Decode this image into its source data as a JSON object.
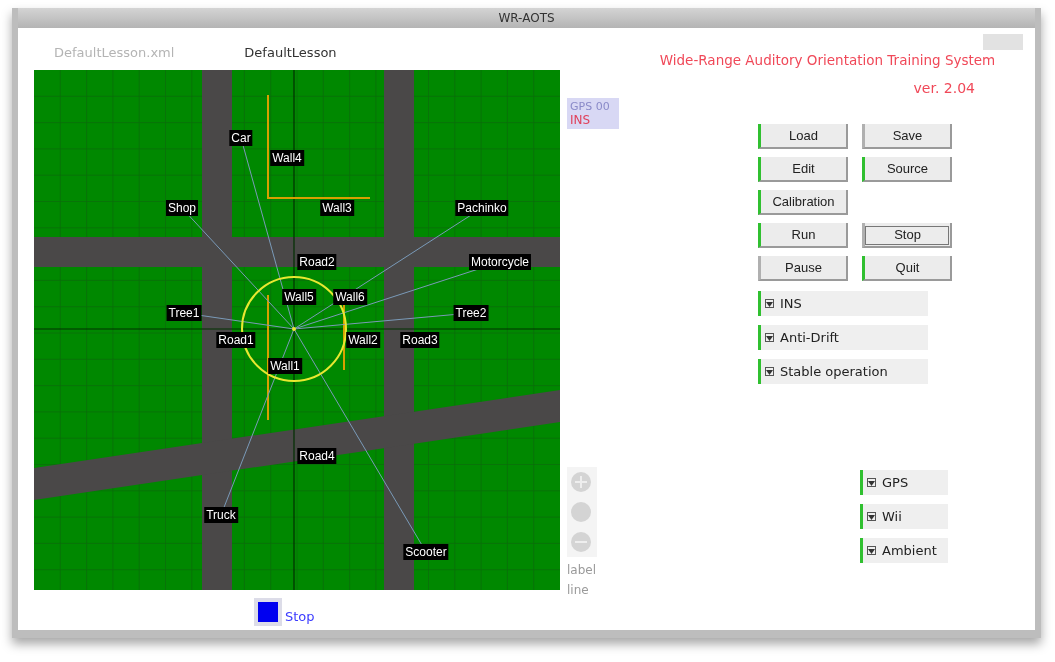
{
  "window": {
    "title": "WR-AOTS"
  },
  "header": {
    "file": "DefaultLesson.xml",
    "lesson": "DefaultLesson"
  },
  "map": {
    "labels": [
      {
        "text": "Car"
      },
      {
        "text": "Wall4"
      },
      {
        "text": "Shop"
      },
      {
        "text": "Wall3"
      },
      {
        "text": "Pachinko"
      },
      {
        "text": "Road2"
      },
      {
        "text": "Motorcycle"
      },
      {
        "text": "Wall5"
      },
      {
        "text": "Wall6"
      },
      {
        "text": "Tree1"
      },
      {
        "text": "Tree2"
      },
      {
        "text": "Road1"
      },
      {
        "text": "Wall2"
      },
      {
        "text": "Road3"
      },
      {
        "text": "Wall1"
      },
      {
        "text": "Road4"
      },
      {
        "text": "Truck"
      },
      {
        "text": "Scooter"
      }
    ]
  },
  "run_state": {
    "label": "Stop"
  },
  "status": {
    "gps": "GPS 00",
    "ins": "INS"
  },
  "zoom_panel": {
    "texts": [
      "label",
      "line"
    ]
  },
  "app_title": "Wide-Range Auditory Orientation Training System",
  "version": "ver. 2.04",
  "buttons": [
    {
      "label": "Load",
      "active": true,
      "pressed": false
    },
    {
      "label": "Save",
      "active": false,
      "pressed": false
    },
    {
      "label": "Edit",
      "active": true,
      "pressed": false
    },
    {
      "label": "Source",
      "active": true,
      "pressed": false
    },
    {
      "label": "Calibration",
      "active": true,
      "pressed": false
    },
    {
      "label": "Run",
      "active": true,
      "pressed": false
    },
    {
      "label": "Stop",
      "active": false,
      "pressed": true
    },
    {
      "label": "Pause",
      "active": false,
      "pressed": false
    },
    {
      "label": "Quit",
      "active": true,
      "pressed": false
    }
  ],
  "options": [
    {
      "label": "INS",
      "checked": true
    },
    {
      "label": "Anti-Drift",
      "checked": true
    },
    {
      "label": "Stable operation",
      "checked": true
    }
  ],
  "sources": [
    {
      "label": "GPS",
      "checked": true
    },
    {
      "label": "Wii",
      "checked": true
    },
    {
      "label": "Ambient",
      "checked": true
    }
  ]
}
